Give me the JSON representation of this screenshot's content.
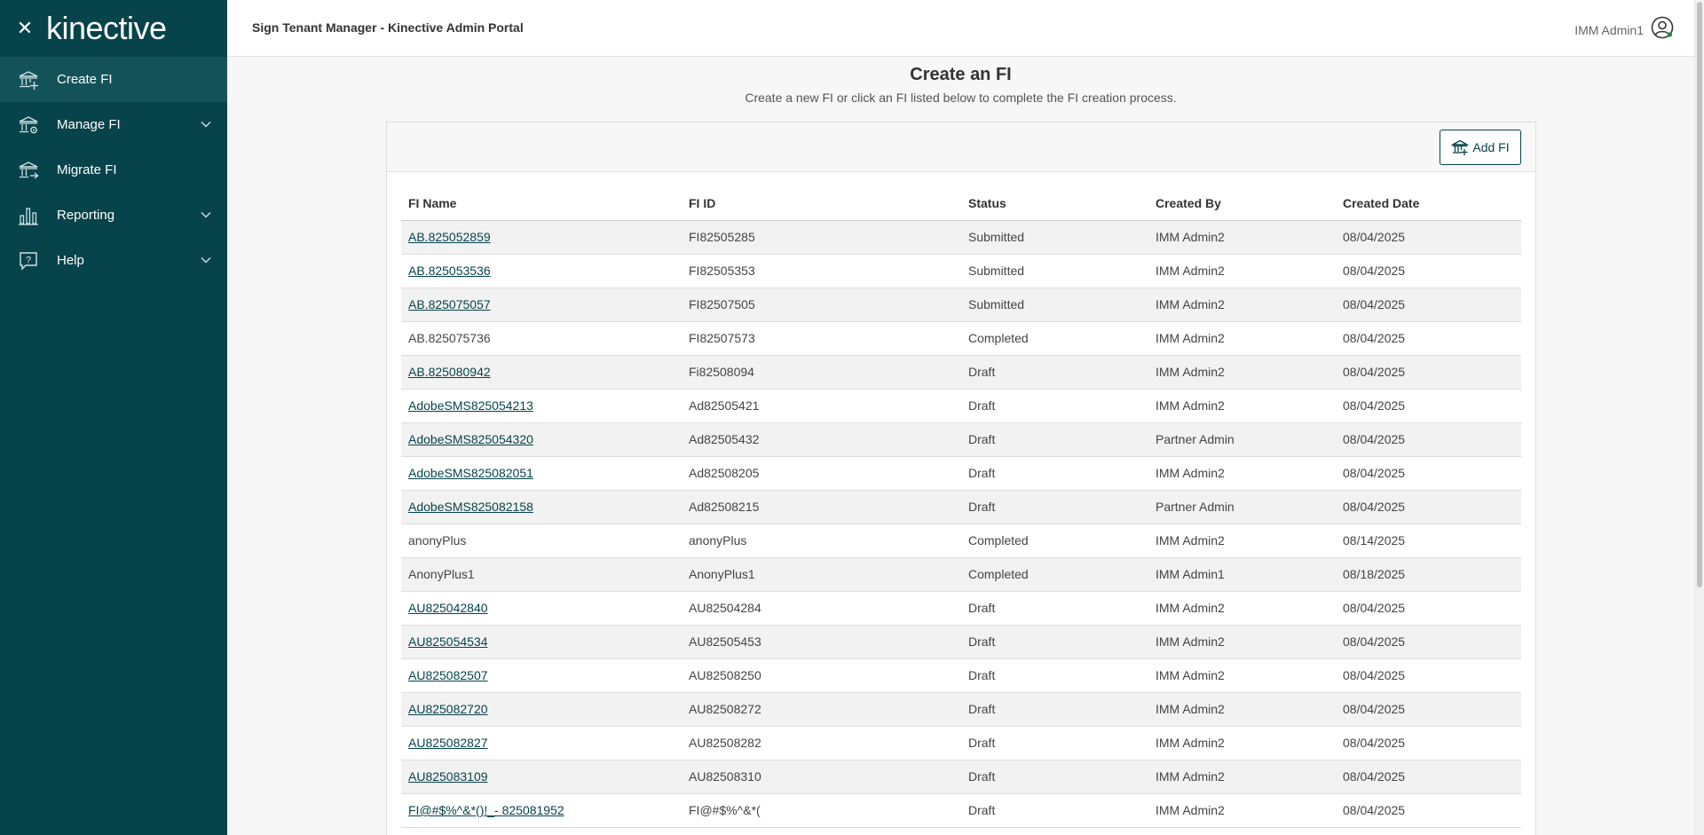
{
  "brand": {
    "logo_text": "kinective",
    "close_icon": "close-icon"
  },
  "sidebar": {
    "items": [
      {
        "label": "Create FI",
        "icon": "bank-plus-icon",
        "active": true,
        "has_chevron": false
      },
      {
        "label": "Manage FI",
        "icon": "bank-gear-icon",
        "active": false,
        "has_chevron": true
      },
      {
        "label": "Migrate FI",
        "icon": "bank-arrow-icon",
        "active": false,
        "has_chevron": false
      },
      {
        "label": "Reporting",
        "icon": "bar-chart-icon",
        "active": false,
        "has_chevron": true
      },
      {
        "label": "Help",
        "icon": "help-bubble-icon",
        "active": false,
        "has_chevron": true
      }
    ]
  },
  "header": {
    "title": "Sign Tenant Manager - Kinective Admin Portal",
    "user_name": "IMM Admin1"
  },
  "main": {
    "title": "Create an FI",
    "subtitle": "Create a new FI or click an FI listed below to complete the FI creation process.",
    "add_button_label": "Add FI"
  },
  "table": {
    "columns": [
      "FI Name",
      "FI ID",
      "Status",
      "Created By",
      "Created Date"
    ],
    "rows": [
      {
        "name": "AB.825052859",
        "link": true,
        "id": "FI82505285",
        "status": "Submitted",
        "created_by": "IMM Admin2",
        "date": "08/04/2025"
      },
      {
        "name": "AB.825053536",
        "link": true,
        "id": "FI82505353",
        "status": "Submitted",
        "created_by": "IMM Admin2",
        "date": "08/04/2025"
      },
      {
        "name": "AB.825075057",
        "link": true,
        "id": "FI82507505",
        "status": "Submitted",
        "created_by": "IMM Admin2",
        "date": "08/04/2025"
      },
      {
        "name": "AB.825075736",
        "link": false,
        "id": "FI82507573",
        "status": "Completed",
        "created_by": "IMM Admin2",
        "date": "08/04/2025"
      },
      {
        "name": "AB.825080942",
        "link": true,
        "id": "Fi82508094",
        "status": "Draft",
        "created_by": "IMM Admin2",
        "date": "08/04/2025"
      },
      {
        "name": "AdobeSMS825054213",
        "link": true,
        "id": "Ad82505421",
        "status": "Draft",
        "created_by": "IMM Admin2",
        "date": "08/04/2025"
      },
      {
        "name": "AdobeSMS825054320",
        "link": true,
        "id": "Ad82505432",
        "status": "Draft",
        "created_by": "Partner Admin",
        "date": "08/04/2025"
      },
      {
        "name": "AdobeSMS825082051",
        "link": true,
        "id": "Ad82508205",
        "status": "Draft",
        "created_by": "IMM Admin2",
        "date": "08/04/2025"
      },
      {
        "name": "AdobeSMS825082158",
        "link": true,
        "id": "Ad82508215",
        "status": "Draft",
        "created_by": "Partner Admin",
        "date": "08/04/2025"
      },
      {
        "name": "anonyPlus",
        "link": false,
        "id": "anonyPlus",
        "status": "Completed",
        "created_by": "IMM Admin2",
        "date": "08/14/2025"
      },
      {
        "name": "AnonyPlus1",
        "link": false,
        "id": "AnonyPlus1",
        "status": "Completed",
        "created_by": "IMM Admin1",
        "date": "08/18/2025"
      },
      {
        "name": "AU825042840",
        "link": true,
        "id": "AU82504284",
        "status": "Draft",
        "created_by": "IMM Admin2",
        "date": "08/04/2025"
      },
      {
        "name": "AU825054534",
        "link": true,
        "id": "AU82505453",
        "status": "Draft",
        "created_by": "IMM Admin2",
        "date": "08/04/2025"
      },
      {
        "name": "AU825082507",
        "link": true,
        "id": "AU82508250",
        "status": "Draft",
        "created_by": "IMM Admin2",
        "date": "08/04/2025"
      },
      {
        "name": "AU825082720",
        "link": true,
        "id": "AU82508272",
        "status": "Draft",
        "created_by": "IMM Admin2",
        "date": "08/04/2025"
      },
      {
        "name": "AU825082827",
        "link": true,
        "id": "AU82508282",
        "status": "Draft",
        "created_by": "IMM Admin2",
        "date": "08/04/2025"
      },
      {
        "name": "AU825083109",
        "link": true,
        "id": "AU82508310",
        "status": "Draft",
        "created_by": "IMM Admin2",
        "date": "08/04/2025"
      },
      {
        "name": "FI@#$%^&*()!_- 825081952",
        "link": true,
        "id": "FI@#$%^&*(",
        "status": "Draft",
        "created_by": "IMM Admin2",
        "date": "08/04/2025"
      }
    ]
  },
  "colors": {
    "sidebar_bg": "#07434a",
    "sidebar_active": "#14525a",
    "accent": "#07434a"
  }
}
